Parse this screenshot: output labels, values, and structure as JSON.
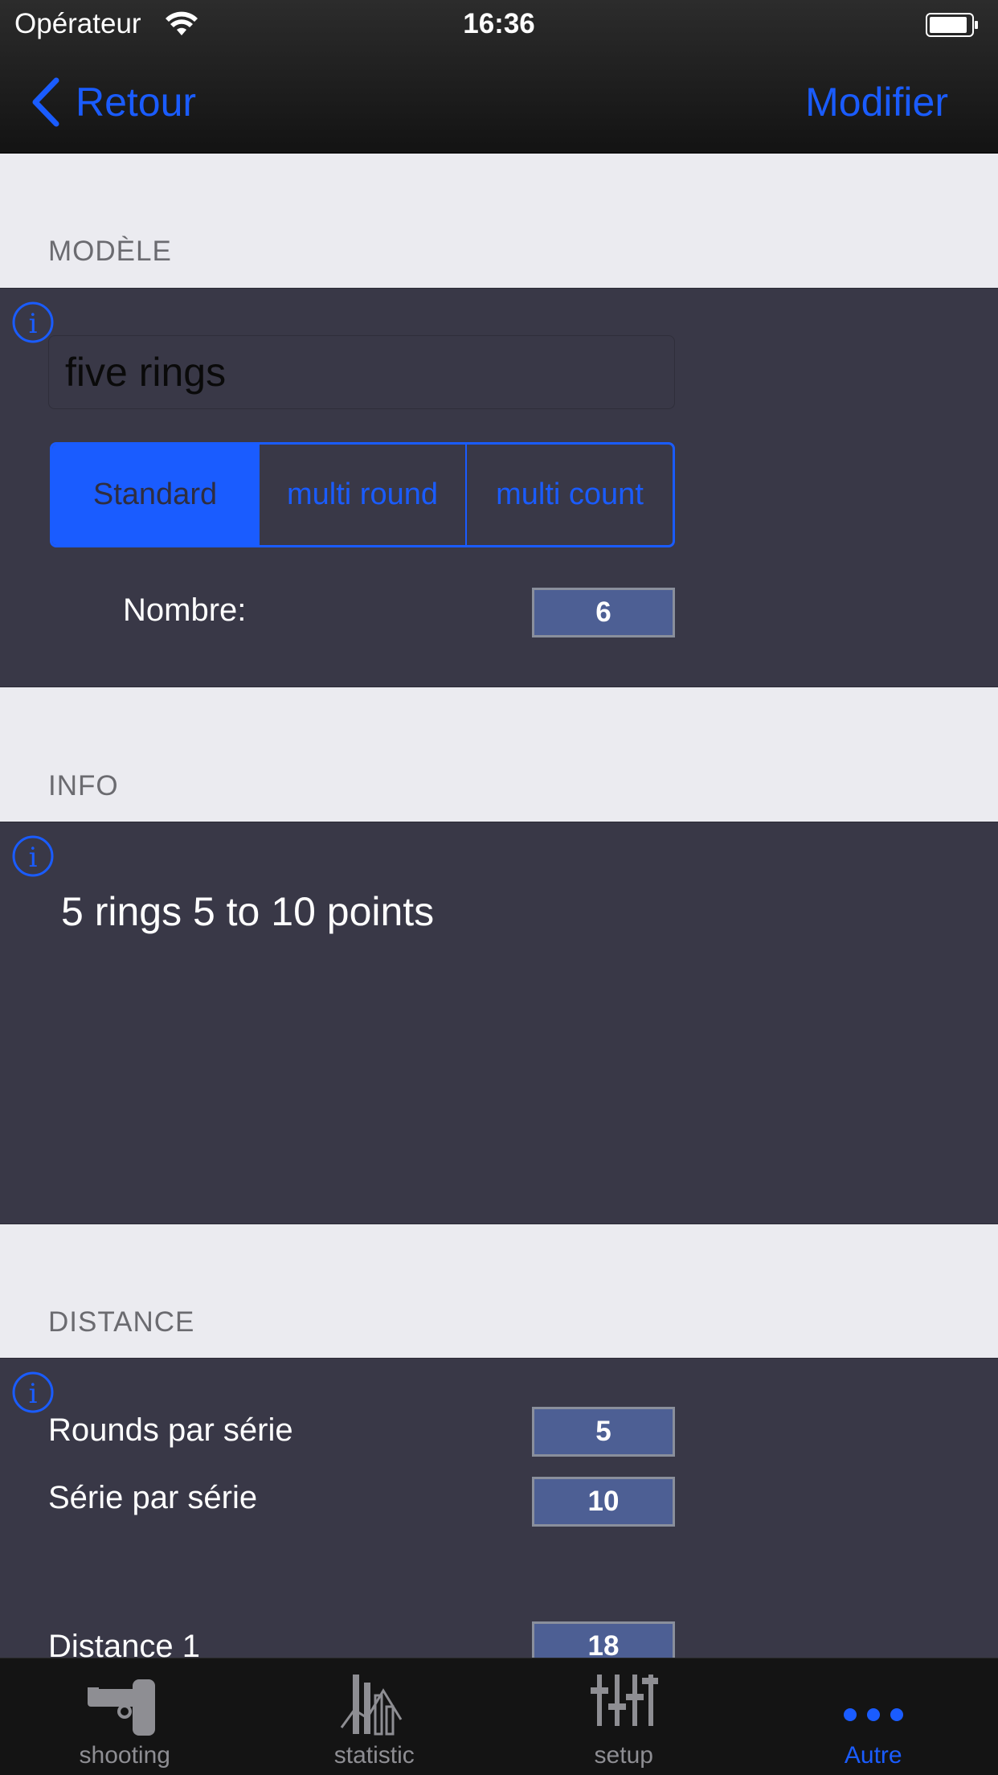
{
  "status": {
    "carrier": "Opérateur",
    "time": "16:36"
  },
  "nav": {
    "back_label": "Retour",
    "edit_label": "Modifier"
  },
  "colors": {
    "accent": "#1a5cff",
    "panel": "#393847",
    "value_box": "#4d5f94"
  },
  "modele": {
    "header": "MODÈLE",
    "name_value": "five rings",
    "segments": [
      "Standard",
      "multi round",
      "multi count"
    ],
    "selected_segment": "Standard",
    "nombre_label": "Nombre:",
    "nombre_value": "6"
  },
  "info": {
    "header": "INFO",
    "text": "5 rings 5 to 10 points"
  },
  "distance": {
    "header": "DISTANCE",
    "rounds_label": "Rounds par série",
    "rounds_value": "5",
    "serie_label": "Série par série",
    "serie_value": "10",
    "distance1_label": "Distance 1",
    "distance1_value": "18"
  },
  "tabs": [
    {
      "label": "shooting",
      "icon": "pistol-icon"
    },
    {
      "label": "statistic",
      "icon": "statistic-icon"
    },
    {
      "label": "setup",
      "icon": "sliders-icon"
    },
    {
      "label": "Autre",
      "icon": "more-icon",
      "active": true
    }
  ]
}
